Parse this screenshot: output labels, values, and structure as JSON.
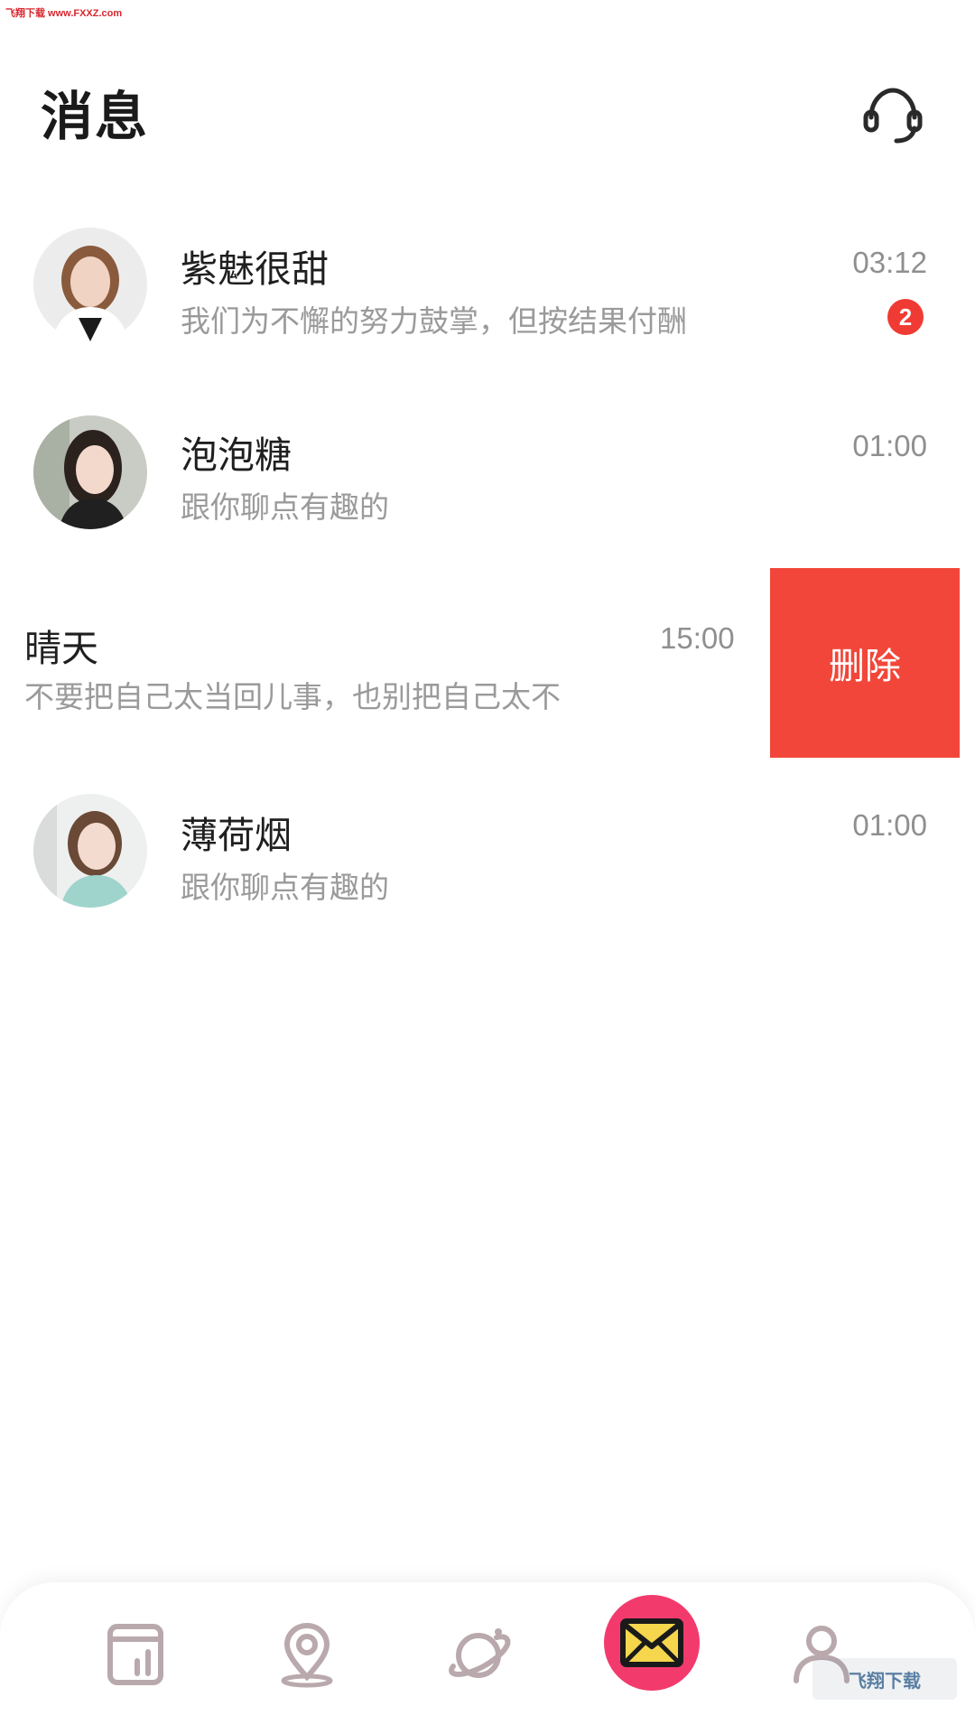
{
  "watermark": {
    "top": "飞翔下载 www.FXXZ.com",
    "bottom": "飞翔下载"
  },
  "header": {
    "title": "消息"
  },
  "conversations": [
    {
      "name": "紫魅很甜",
      "preview": "我们为不懈的努力鼓掌，但按结果付酬",
      "time": "03:12",
      "unread": "2"
    },
    {
      "name": "泡泡糖",
      "preview": "跟你聊点有趣的",
      "time": "01:00"
    },
    {
      "name": "晴天",
      "preview": "不要把自己太当回儿事，也别把自己太不",
      "time": "15:00",
      "action_label": "删除"
    },
    {
      "name": "薄荷烟",
      "preview": "跟你聊点有趣的",
      "time": "01:00"
    }
  ],
  "nav": {
    "items": [
      "home-icon",
      "location-icon",
      "planet-icon",
      "mail-icon",
      "profile-icon"
    ],
    "active": "mail-icon"
  },
  "colors": {
    "badge": "#ef3b33",
    "delete_action": "#f2463a",
    "nav_active": "#f23a6d",
    "nav_icon": "#b9a9ad"
  }
}
